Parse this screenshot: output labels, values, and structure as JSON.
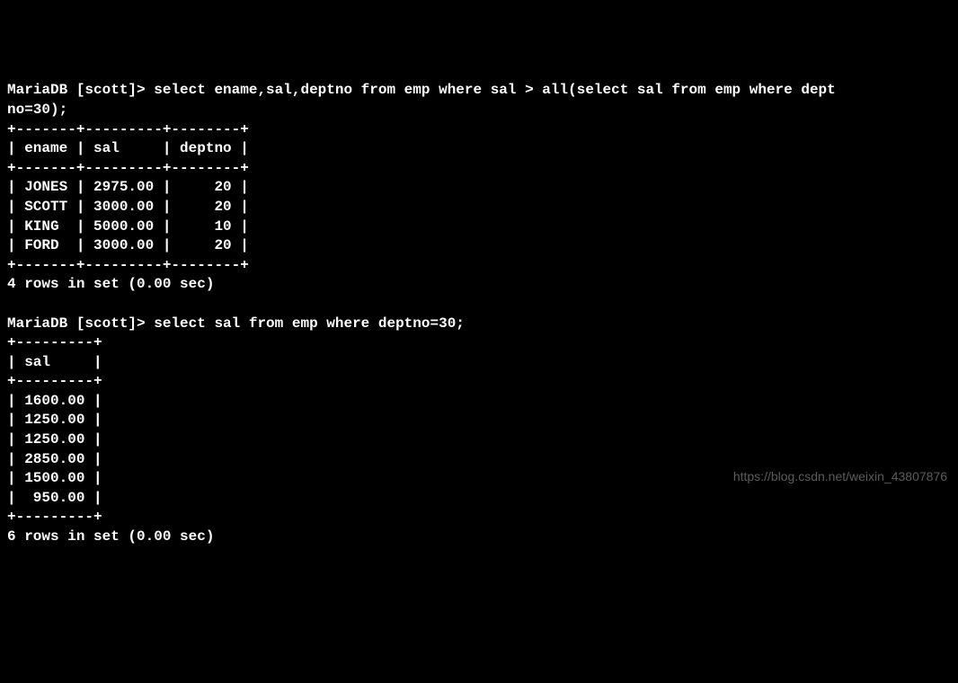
{
  "query1": {
    "prompt": "MariaDB [scott]> ",
    "sql_line1": "select ename,sal,deptno from emp where sal > all(select sal from emp where dept",
    "sql_line2": "no=30);",
    "border_top": "+-------+---------+--------+",
    "header_row": "| ename | sal     | deptno |",
    "border_mid": "+-------+---------+--------+",
    "rows": [
      "| JONES | 2975.00 |     20 |",
      "| SCOTT | 3000.00 |     20 |",
      "| KING  | 5000.00 |     10 |",
      "| FORD  | 3000.00 |     20 |"
    ],
    "border_bot": "+-------+---------+--------+",
    "status": "4 rows in set (0.00 sec)"
  },
  "query2": {
    "prompt": "MariaDB [scott]> ",
    "sql": "select sal from emp where deptno=30;",
    "border_top": "+---------+",
    "header_row": "| sal     |",
    "border_mid": "+---------+",
    "rows": [
      "| 1600.00 |",
      "| 1250.00 |",
      "| 1250.00 |",
      "| 2850.00 |",
      "| 1500.00 |",
      "|  950.00 |"
    ],
    "border_bot": "+---------+",
    "status": "6 rows in set (0.00 sec)"
  },
  "watermark": "https://blog.csdn.net/weixin_43807876"
}
